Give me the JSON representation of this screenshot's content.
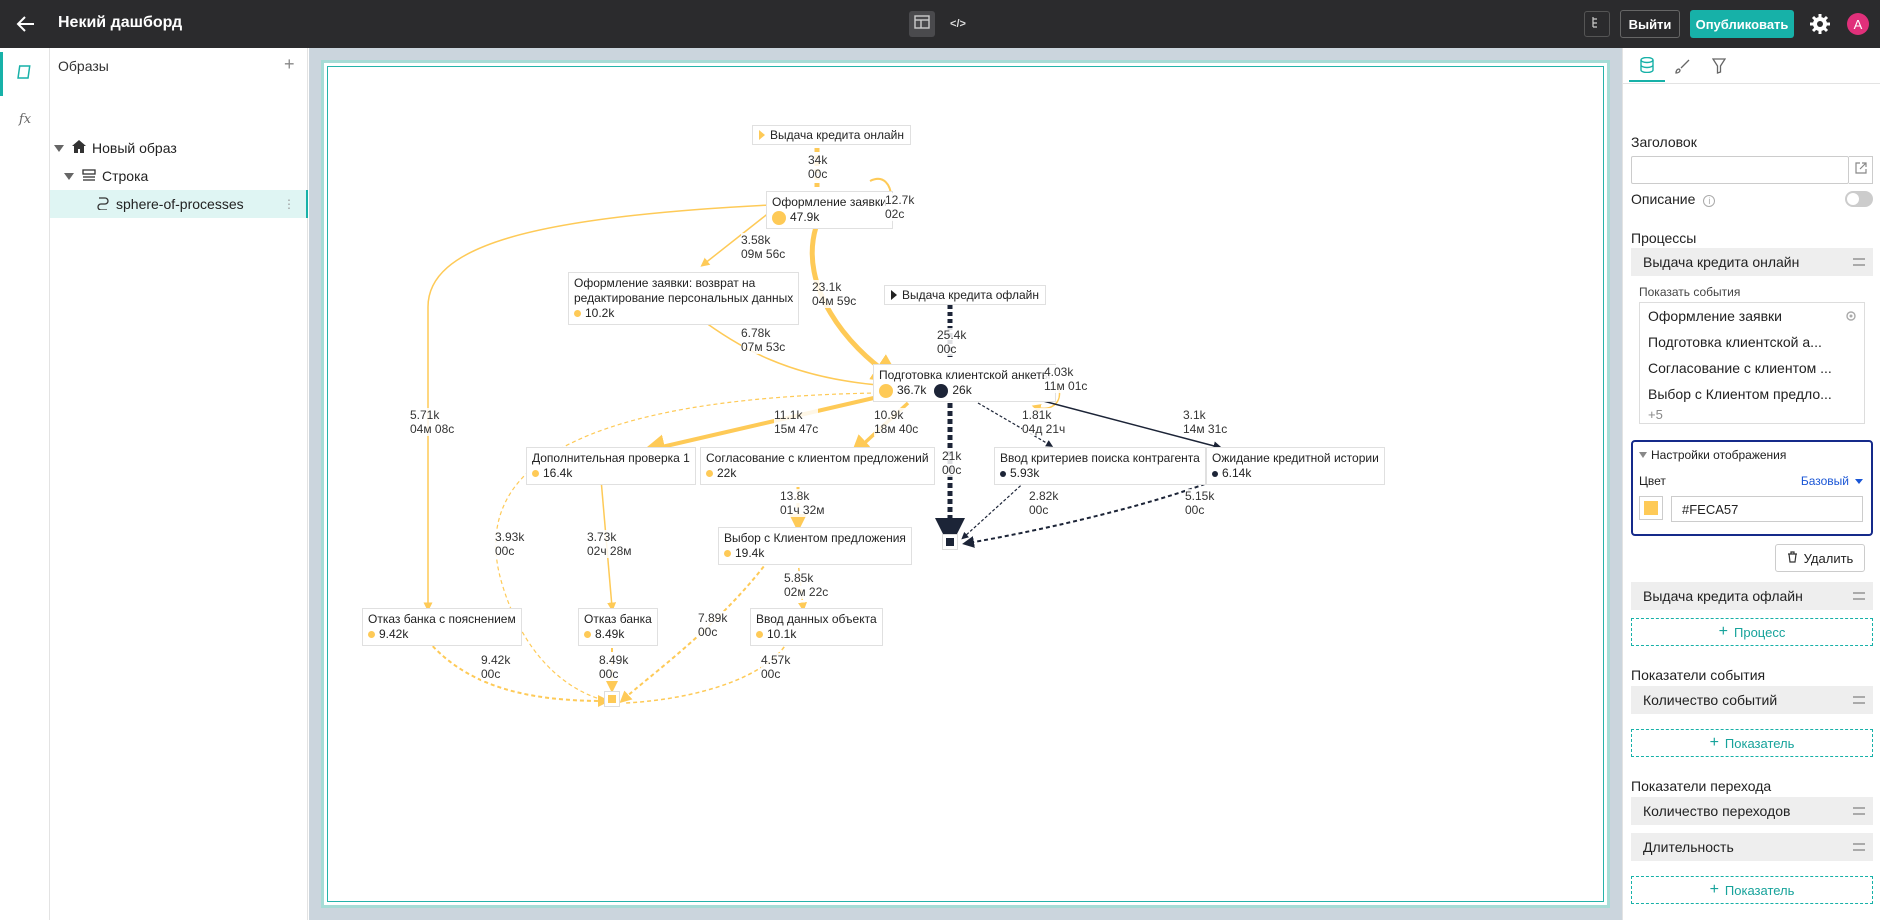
{
  "header": {
    "title": "Некий дашборд",
    "exit_label": "Выйти",
    "publish_label": "Опубликовать",
    "avatar_letter": "A",
    "mode_code_label": "</>"
  },
  "rail": {
    "formula_label": "fx"
  },
  "tree": {
    "heading": "Образы",
    "add": "+",
    "items": [
      {
        "label": "Новый образ"
      },
      {
        "label": "Строка"
      },
      {
        "label": "sphere-of-processes"
      }
    ]
  },
  "graph": {
    "starts": [
      {
        "label": "Выдача кредита онлайн",
        "color": "#FECA57"
      },
      {
        "label": "Выдача кредита офлайн",
        "color": "#222222"
      }
    ],
    "nodes": [
      {
        "label": "Оформление заявки",
        "count": "47.9k"
      },
      {
        "label": "Оформление заявки: возврат на",
        "label2": "редактирование персональных данных",
        "count": "10.2k"
      },
      {
        "label": "Подготовка клиентской анкеты",
        "count": "36.7k",
        "count2": "26k"
      },
      {
        "label": "Дополнительная проверка 1",
        "count": "16.4k"
      },
      {
        "label": "Согласование с клиентом предложений",
        "count": "22k"
      },
      {
        "label": "Ввод критериев поиска контрагента",
        "count": "5.93k"
      },
      {
        "label": "Ожидание кредитной истории",
        "count": "6.14k"
      },
      {
        "label": "Выбор с Клиентом предложения",
        "count": "19.4k"
      },
      {
        "label": "Отказ банка с пояснением",
        "count": "9.42k"
      },
      {
        "label": "Отказ банка",
        "count": "8.49k"
      },
      {
        "label": "Ввод данных объекта",
        "count": "10.1k"
      }
    ],
    "edge_labels": [
      {
        "a": "34k",
        "b": "00с"
      },
      {
        "a": "12.7k",
        "b": "02с"
      },
      {
        "a": "3.58k",
        "b": "09м 56с"
      },
      {
        "a": "23.1k",
        "b": "04м 59с"
      },
      {
        "a": "6.78k",
        "b": "07м 53с"
      },
      {
        "a": "25.4k",
        "b": "00с"
      },
      {
        "a": "4.03k",
        "b": "11м 01с"
      },
      {
        "a": "5.71k",
        "b": "04м 08с"
      },
      {
        "a": "11.1k",
        "b": "15м 47с"
      },
      {
        "a": "10.9k",
        "b": "18м 40с"
      },
      {
        "a": "1.81k",
        "b": "04д 21ч"
      },
      {
        "a": "3.1k",
        "b": "14м 31с"
      },
      {
        "a": "21k",
        "b": "00с"
      },
      {
        "a": "13.8k",
        "b": "01ч 32м"
      },
      {
        "a": "3.93k",
        "b": "00с"
      },
      {
        "a": "3.73k",
        "b": "02ч 28м"
      },
      {
        "a": "2.82k",
        "b": "00с"
      },
      {
        "a": "5.15k",
        "b": "00с"
      },
      {
        "a": "5.85k",
        "b": "02м 22с"
      },
      {
        "a": "7.89k",
        "b": "00с"
      },
      {
        "a": "9.42k",
        "b": "00с"
      },
      {
        "a": "8.49k",
        "b": "00с"
      },
      {
        "a": "4.57k",
        "b": "00с"
      }
    ]
  },
  "panel": {
    "heading_label": "Заголовок",
    "heading_value": "",
    "description_label": "Описание",
    "processes_label": "Процессы",
    "process1": "Выдача кредита онлайн",
    "show_events_label": "Показать события",
    "events": [
      "Оформление заявки",
      "Подготовка клиентской а...",
      "Согласование с клиентом ...",
      "Выбор с Клиентом предло..."
    ],
    "events_more": "+5",
    "display_settings_label": "Настройки отображения",
    "color_label": "Цвет",
    "color_mode": "Базовый",
    "color_value": "#FECA57",
    "delete_label": "Удалить",
    "process2": "Выдача кредита офлайн",
    "add_process_label": "Процесс",
    "event_metrics_label": "Показатели события",
    "event_metric1": "Количество событий",
    "add_metric_label": "Показатель",
    "transition_metrics_label": "Показатели перехода",
    "transition_metric1": "Количество переходов",
    "transition_metric2": "Длительность",
    "add_metric_label2": "Показатель"
  }
}
